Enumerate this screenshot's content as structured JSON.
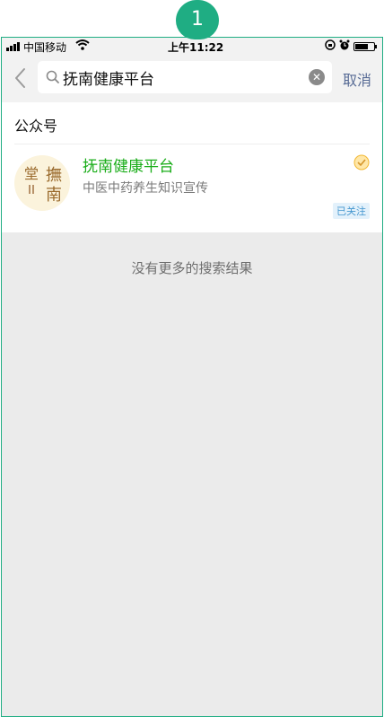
{
  "step": {
    "number": "1"
  },
  "statusbar": {
    "carrier": "中国移动",
    "time": "上午11:22",
    "wifi_icon": "wifi-icon",
    "orientation_lock_icon": "orientation-lock-icon",
    "alarm_icon": "alarm-icon",
    "battery_icon": "battery-icon"
  },
  "search": {
    "query": "抚南健康平台",
    "cancel_label": "取消"
  },
  "section": {
    "title": "公众号"
  },
  "result": {
    "name": "抚南健康平台",
    "description": "中医中药养生知识宣传",
    "status_badge": "已关注",
    "avatar_text": "撫南堂"
  },
  "footer": {
    "no_more_text": "没有更多的搜索结果"
  },
  "colors": {
    "accent_green": "#1aad19",
    "link_blue": "#576b95",
    "badge_teal": "#1fad83"
  }
}
